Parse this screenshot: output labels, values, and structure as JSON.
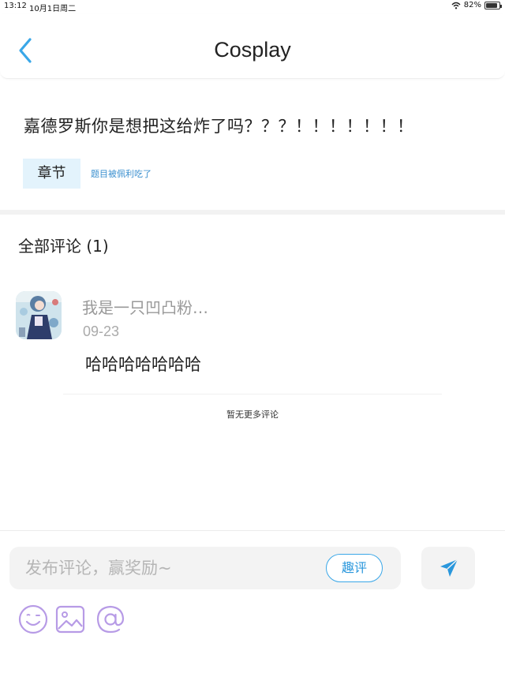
{
  "status_bar": {
    "time": "13:12",
    "date": "10月1日周二",
    "battery": "82%"
  },
  "header": {
    "title": "Cosplay"
  },
  "post": {
    "text": "嘉德罗斯你是想把这给炸了吗？？？！！！！！！！",
    "chapter_label": "章节",
    "chapter_desc": "题目被佩利吃了"
  },
  "comments": {
    "heading": "全部评论 (1)",
    "items": [
      {
        "user": "我是一只凹凸粉…",
        "date": "09-23",
        "text": "哈哈哈哈哈哈哈"
      }
    ],
    "no_more": "暂无更多评论"
  },
  "composer": {
    "placeholder": "发布评论，赢奖励~",
    "quping_label": "趣评"
  },
  "colors": {
    "accent": "#3aa7e8",
    "tool_icon": "#b79be6"
  },
  "icons": [
    "back-chevron-icon",
    "send-icon",
    "emoji-icon",
    "image-icon",
    "at-icon",
    "wifi-icon",
    "battery-icon"
  ]
}
